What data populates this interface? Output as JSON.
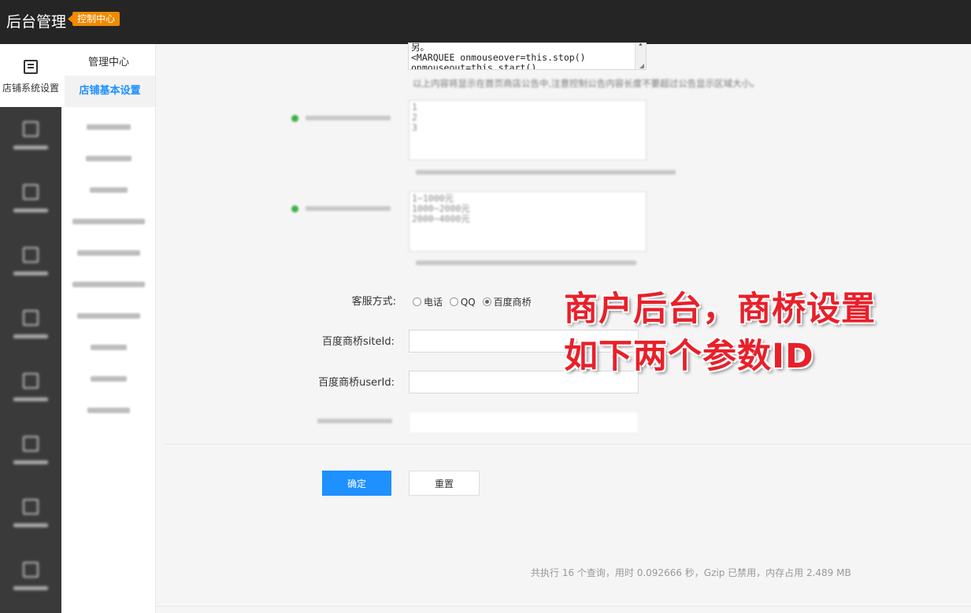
{
  "topbar": {
    "title": "后台管理",
    "badge": "控制中心"
  },
  "rail": {
    "active_label": "店铺系统设置",
    "items": [
      "item-1",
      "item-2",
      "item-3",
      "item-4",
      "item-5",
      "item-6",
      "item-7",
      "item-8"
    ]
  },
  "subnav": {
    "title": "管理中心",
    "active": "店铺基本设置"
  },
  "main": {
    "textarea_top": "另。\n<MARQUEE onmouseover=this.stop()\nonmouseout=this.start()",
    "textarea_top_hint": "以上内容将显示在首页商店公告中,注意控制公告内容长度不要超过公告显示区域大小。",
    "textarea_mid": "1\n2\n3",
    "textarea_low": "1~1000元\n1000~2000元\n2000~4000元",
    "kefu_label": "客服方式:",
    "kefu_options": [
      "电话",
      "QQ",
      "百度商桥"
    ],
    "kefu_selected": "百度商桥",
    "siteid_label": "百度商桥siteId:",
    "siteid_value": "",
    "userid_label": "百度商桥userId:",
    "userid_value": "",
    "ok_button": "确定",
    "reset_button": "重置",
    "footer": "共执行 16 个查询，用时 0.092666 秒，Gzip 已禁用，内存占用 2.489 MB"
  },
  "annotation": {
    "line1": "商户后台，商桥设置",
    "line2": "如下两个参数ID"
  },
  "colors": {
    "accent": "#1e90ff",
    "topbar": "#252525",
    "badge": "#f08a00",
    "annotation": "#e8202a"
  }
}
